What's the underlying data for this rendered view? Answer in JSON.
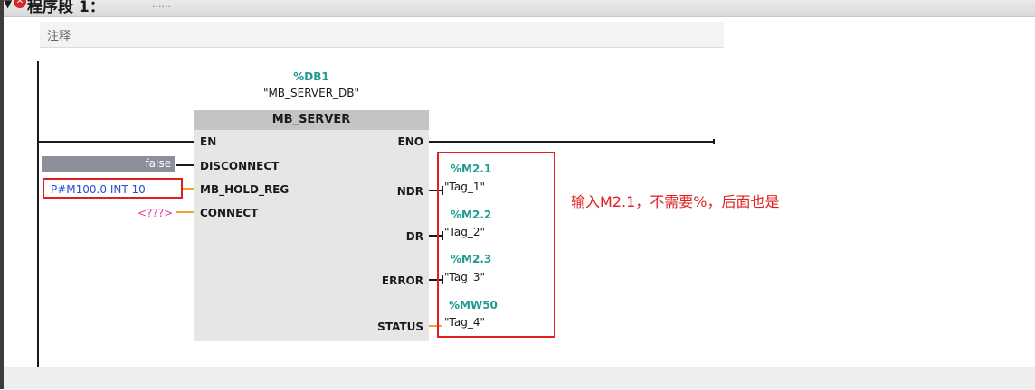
{
  "network": {
    "title": "程序段 1：",
    "dots": "......",
    "comment": "注释"
  },
  "block": {
    "db_address": "%DB1",
    "db_name": "\"MB_SERVER_DB\"",
    "type": "MB_SERVER",
    "inputs": {
      "en": "EN",
      "disconnect": "DISCONNECT",
      "mb_hold_reg": "MB_HOLD_REG",
      "connect": "CONNECT"
    },
    "outputs": {
      "eno": "ENO",
      "ndr": "NDR",
      "dr": "DR",
      "error": "ERROR",
      "status": "STATUS"
    }
  },
  "params": {
    "disconnect_value": "false",
    "mb_hold_reg_value": "P#M100.0 INT 10",
    "connect_value": "<???>",
    "ndr_addr": "%M2.1",
    "ndr_tag": "\"Tag_1\"",
    "dr_addr": "%M2.2",
    "dr_tag": "\"Tag_2\"",
    "error_addr": "%M2.3",
    "error_tag": "\"Tag_3\"",
    "status_addr": "%MW50",
    "status_tag": "\"Tag_4\""
  },
  "annotation": "输入M2.1，不需要%，后面也是",
  "colors": {
    "address_teal": "#1d9a91",
    "highlight_red": "#e02020",
    "wire_orange": "#f0a030",
    "pointer_blue": "#2a4fcf",
    "missing_pink": "#e0409c"
  }
}
